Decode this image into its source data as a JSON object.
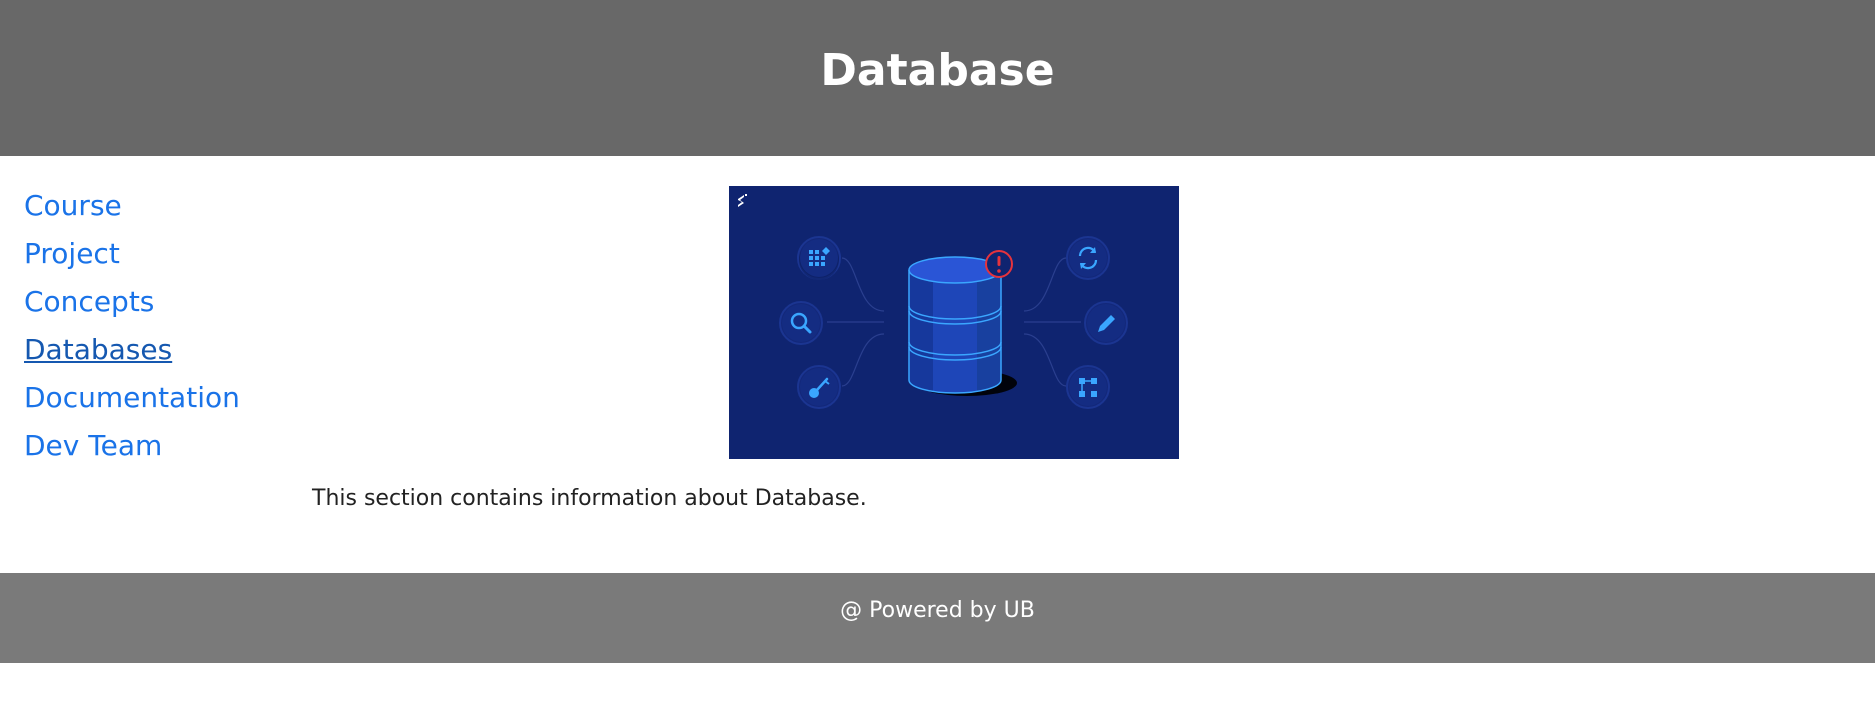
{
  "header": {
    "title": "Database"
  },
  "sidebar": {
    "items": [
      {
        "label": "Course",
        "active": false
      },
      {
        "label": "Project",
        "active": false
      },
      {
        "label": "Concepts",
        "active": false
      },
      {
        "label": "Databases",
        "active": true
      },
      {
        "label": "Documentation",
        "active": false
      },
      {
        "label": "Dev Team",
        "active": false
      }
    ]
  },
  "main": {
    "image": {
      "icons": [
        "grid-shapes-icon",
        "search-icon",
        "key-icon",
        "refresh-icon",
        "pencil-icon",
        "hierarchy-icon",
        "alert-icon",
        "logo-mark-icon"
      ]
    },
    "description": "This section contains information about Database."
  },
  "footer": {
    "text": "@ Powered by UB"
  },
  "colors": {
    "header_bg": "#686868",
    "footer_bg": "#7a7a7a",
    "link": "#1a73e8",
    "link_active": "#1558b0",
    "image_bg": "#0f2470",
    "cylinder": "#2a55d6",
    "icon_accent": "#3aa6ff",
    "alert": "#e5333d"
  }
}
